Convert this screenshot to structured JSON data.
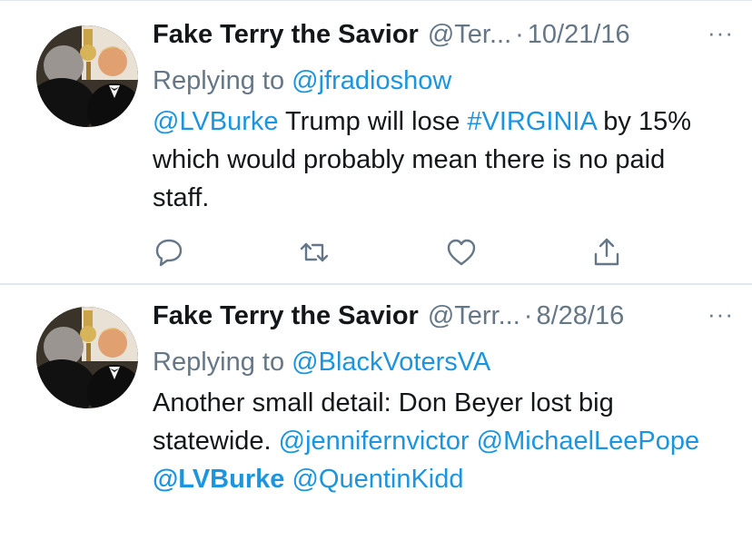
{
  "tweets": [
    {
      "name": "Fake Terry the Savior",
      "handle": "@Ter...",
      "sep": "·",
      "date": "10/21/16",
      "more": "···",
      "replying_prefix": "Replying to ",
      "replying_to": "@jfradioshow",
      "body": {
        "mention1": "@LVBurke",
        "text1": " Trump will lose ",
        "hashtag": "#VIRGINIA",
        "text2": " by 15% which would probably mean there is no paid staff."
      },
      "actions": [
        "reply-icon",
        "retweet-icon",
        "like-icon",
        "share-icon"
      ]
    },
    {
      "name": "Fake Terry the Savior",
      "handle": "@Terr...",
      "sep": "·",
      "date": "8/28/16",
      "more": "···",
      "replying_prefix": "Replying to ",
      "replying_to": "@BlackVotersVA",
      "body": {
        "text1": "Another small detail: Don Beyer lost big statewide. ",
        "mention1": "@jennifernvictor",
        "mention2": "@MichaelLeePope",
        "mention3": "@LVBurke",
        "mention4": "@QuentinKidd"
      }
    }
  ],
  "colors": {
    "link": "#1b95e0",
    "muted": "#657786",
    "text": "#14171a",
    "divider": "#e1e8ed"
  }
}
